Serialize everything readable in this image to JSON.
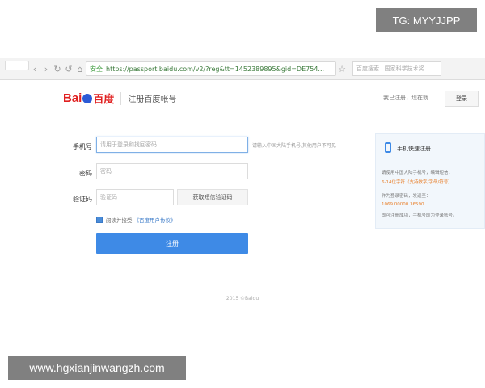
{
  "browser": {
    "secure_label": "安全",
    "url": "https://passport.baidu.com/v2/?reg&tt=1452389895&gid=DE754...",
    "search_placeholder": "百度搜索 · 国家科学技术奖"
  },
  "header": {
    "logo_text": "Bai",
    "logo_cn": "百度",
    "subtitle": "注册百度帐号",
    "links": "我已注册，现在就",
    "login_label": "登录"
  },
  "form": {
    "phone_label": "手机号",
    "phone_placeholder": "请用于登录和找回密码",
    "phone_hint": "请输入中国大陆手机号,其他用户不可见",
    "password_label": "密码",
    "password_placeholder": "密码",
    "code_label": "验证码",
    "code_placeholder": "验证码",
    "get_code_label": "获取短信验证码",
    "agree_text": "阅读并接受",
    "agree_link": "《百度用户协议》",
    "submit_label": "注册"
  },
  "side_panel": {
    "title": "手机快速注册",
    "line1": "请使用中国大陆手机号，编辑短信：",
    "line2": "6-14位字符（支持数字/字母/符号）",
    "line3": "作为登录密码，发送至：",
    "line4": "1069 00000 36590",
    "line5": "即可注册成功，手机号即为登录帐号。"
  },
  "footer": {
    "copyright": "2015 ©Baidu"
  },
  "watermarks": {
    "top": "TG: MYYJJPP",
    "bottom": "www.hgxianjinwangzh.com"
  }
}
